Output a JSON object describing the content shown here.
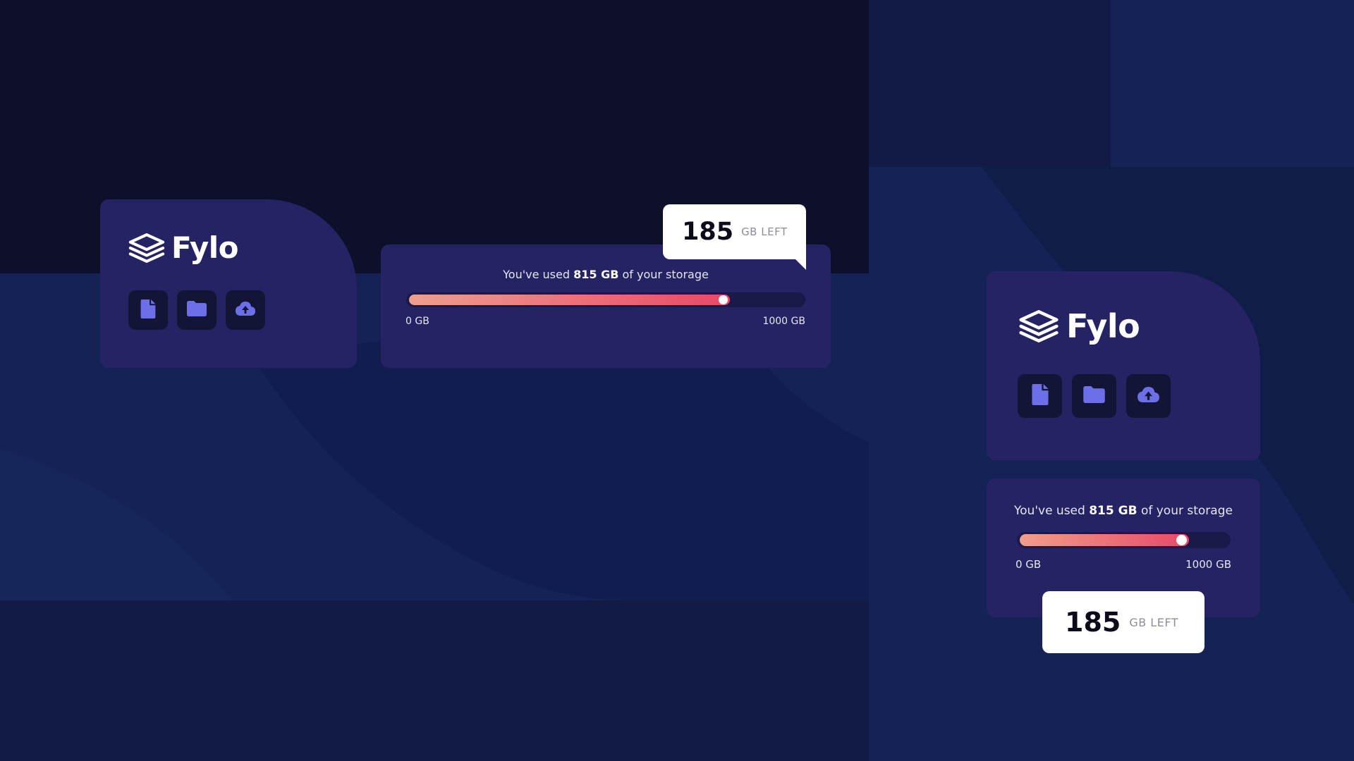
{
  "brand": {
    "name": "Fylo",
    "logo_icon": "layers-icon"
  },
  "toolbar": {
    "icons": [
      "document-icon",
      "folder-icon",
      "upload-icon"
    ]
  },
  "storage": {
    "used_prefix": "You've used ",
    "used_amount": "815 GB",
    "used_suffix": " of your storage",
    "min_label": "0 GB",
    "max_label": "1000 GB",
    "used_fraction": 0.815
  },
  "remaining": {
    "number": "185",
    "unit": "GB LEFT"
  },
  "colors": {
    "card": "#252363",
    "icon_tile": "#131536",
    "icon": "#6c6fe6",
    "bar_start": "#f09e8c",
    "bar_end": "#e74967",
    "text": "#e6e5f5"
  }
}
